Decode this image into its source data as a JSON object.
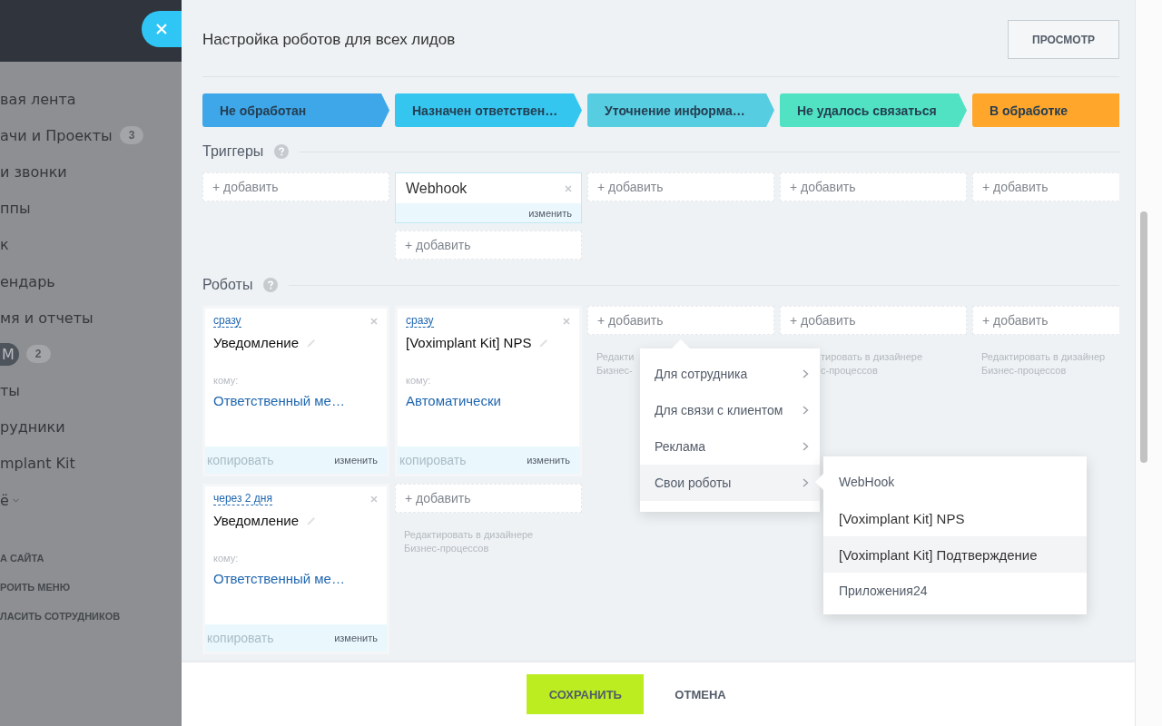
{
  "sidebar": {
    "items": [
      {
        "kind": "link",
        "label": "вая лента",
        "selected": false
      },
      {
        "kind": "link",
        "label": "ачи и Проекты",
        "badge": "3",
        "selected": false
      },
      {
        "kind": "link",
        "label": "и звонки",
        "selected": false
      },
      {
        "kind": "link",
        "label": "ппы",
        "selected": false
      },
      {
        "kind": "link",
        "label": "к",
        "selected": false
      },
      {
        "kind": "link",
        "label": "ендарь",
        "selected": false
      },
      {
        "kind": "link",
        "label": "мя и отчеты",
        "selected": false
      },
      {
        "kind": "link",
        "label": "M",
        "badge": "2",
        "selected": true
      },
      {
        "kind": "link",
        "label": "ты",
        "selected": false
      },
      {
        "kind": "link",
        "label": "рудники",
        "selected": false
      },
      {
        "kind": "link",
        "label": "mplant Kit",
        "selected": false
      },
      {
        "kind": "more",
        "label": "ё",
        "selected": false
      }
    ],
    "footer_links": [
      "А САЙТА",
      "РОИТЬ МЕНЮ",
      "ЛАСИТЬ СОТРУДНИКОВ"
    ]
  },
  "header": {
    "title": "Настройка роботов для всех лидов",
    "preview_button": "ПРОСМОТР"
  },
  "stages": [
    {
      "label": "Не обработан",
      "color": "#3ea7e9"
    },
    {
      "label": "Назначен ответствен…",
      "color": "#35c6f0"
    },
    {
      "label": "Уточнение информа…",
      "color": "#56cde0"
    },
    {
      "label": "Не удалось связаться",
      "color": "#50e2c2"
    },
    {
      "label": "В обработке",
      "color": "#ffa62b"
    }
  ],
  "triggers": {
    "title": "Триггеры",
    "columns": [
      {
        "items": [
          {
            "kind": "add",
            "label": "+ добавить"
          }
        ]
      },
      {
        "items": [
          {
            "kind": "trigger",
            "name": "Webhook",
            "edit": "изменить"
          },
          {
            "kind": "add",
            "label": "+ добавить"
          }
        ]
      },
      {
        "items": [
          {
            "kind": "add",
            "label": "+ добавить"
          }
        ]
      },
      {
        "items": [
          {
            "kind": "add",
            "label": "+ добавить"
          }
        ]
      },
      {
        "items": [
          {
            "kind": "add",
            "label": "+ добавить"
          }
        ]
      }
    ]
  },
  "robots": {
    "title": "Роботы",
    "columns": [
      {
        "items": [
          {
            "kind": "robot",
            "delay": "сразу",
            "name": "Уведомление",
            "to_label": "кому:",
            "to": "Ответственный ме…",
            "copy": "копировать",
            "edit": "изменить"
          },
          {
            "kind": "robot",
            "delay": "через 2 дня",
            "name": "Уведомление",
            "to_label": "кому:",
            "to": "Ответственный ме…",
            "copy": "копировать",
            "edit": "изменить"
          }
        ]
      },
      {
        "items": [
          {
            "kind": "robot",
            "delay": "сразу",
            "name": "[Voximplant Kit] NPS",
            "to_label": "кому:",
            "to": "Автоматически",
            "copy": "копировать",
            "edit": "изменить"
          },
          {
            "kind": "add",
            "label": "+ добавить"
          },
          {
            "kind": "hint",
            "lines": [
              "Редактировать в дизайнере",
              "Бизнес-процессов"
            ]
          }
        ]
      },
      {
        "items": [
          {
            "kind": "add",
            "label": "+ добавить"
          },
          {
            "kind": "hint",
            "lines": [
              "Редакти",
              "Бизнес-"
            ]
          }
        ]
      },
      {
        "items": [
          {
            "kind": "add",
            "label": "+ добавить"
          },
          {
            "kind": "hint_cut",
            "lines": [
              "тировать в дизайнере",
              "с-процессов"
            ]
          }
        ]
      },
      {
        "items": [
          {
            "kind": "add",
            "label": "+ добавить"
          },
          {
            "kind": "hint",
            "lines": [
              "Редактировать в дизайнер",
              "Бизнес-процессов"
            ]
          }
        ]
      }
    ]
  },
  "menu": {
    "items": [
      {
        "label": "Для сотрудника",
        "selected": false
      },
      {
        "label": "Для связи с клиентом",
        "selected": false
      },
      {
        "label": "Реклама",
        "selected": false
      },
      {
        "label": "Свои роботы",
        "selected": true
      }
    ],
    "submenu": {
      "items": [
        {
          "label": "WebHook",
          "selected": false
        },
        {
          "label": "[Voximplant Kit] NPS",
          "selected": false
        },
        {
          "label": "[Voximplant Kit] Подтверждение",
          "selected": true
        },
        {
          "label": "Приложения24",
          "selected": false
        }
      ]
    }
  },
  "footer": {
    "save": "СОХРАНИТЬ",
    "cancel": "ОТМЕНА"
  }
}
